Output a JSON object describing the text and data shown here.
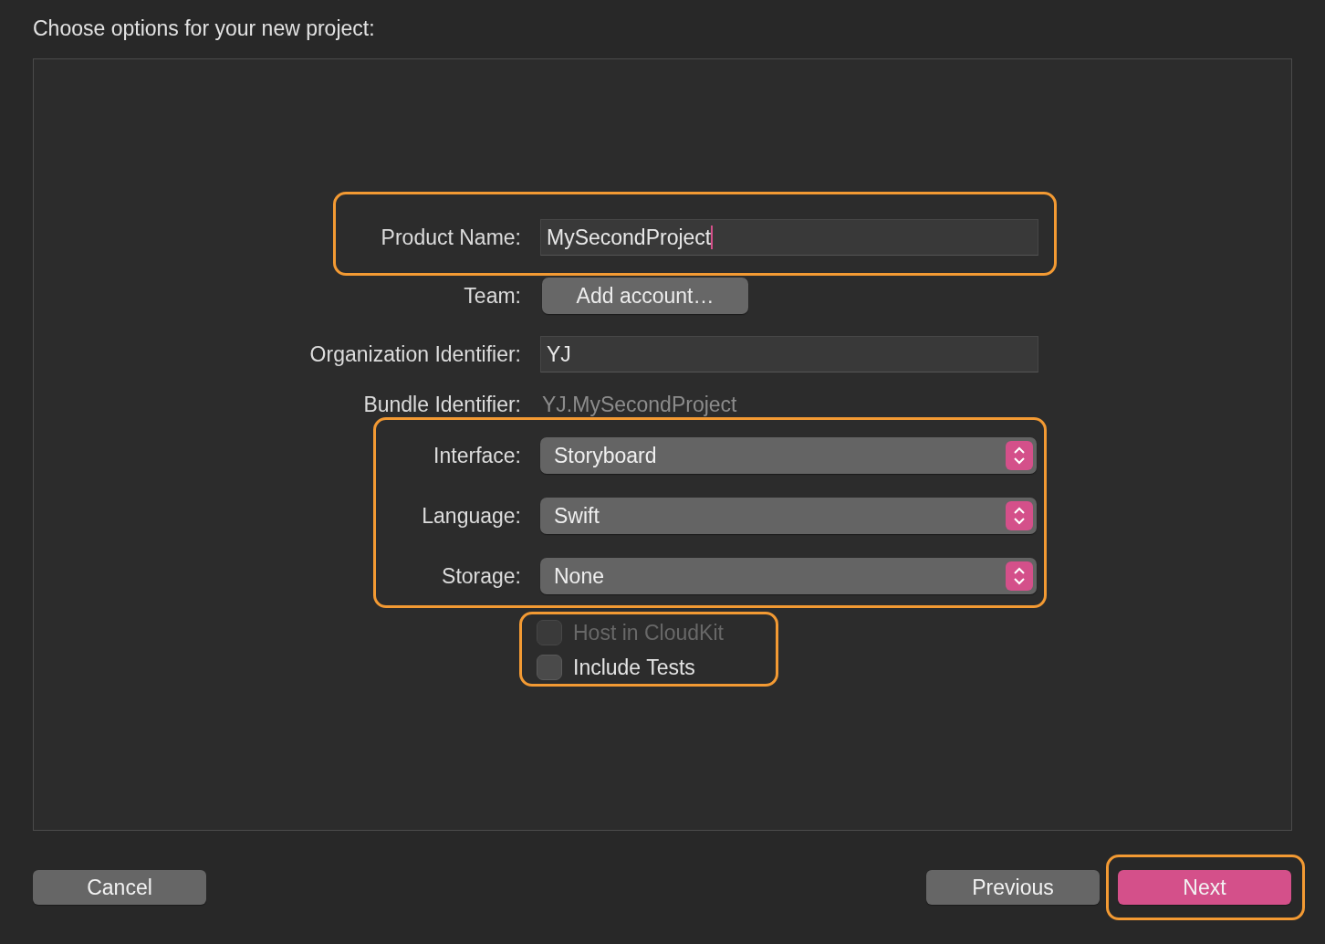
{
  "heading": "Choose options for your new project:",
  "sections": [
    {
      "highlighted": true,
      "rows": [
        {
          "kind": "text",
          "label": "Product Name:",
          "value": "MySecondProject",
          "focused": true
        }
      ]
    },
    {
      "rows": [
        {
          "kind": "button",
          "label": "Team:",
          "value": "Add account…"
        },
        {
          "kind": "text",
          "label": "Organization Identifier:",
          "value": "YJ",
          "focused": false
        },
        {
          "kind": "static",
          "label": "Bundle Identifier:",
          "value": "YJ.MySecondProject"
        }
      ]
    },
    {
      "highlighted": true,
      "rows": [
        {
          "kind": "popup",
          "label": "Interface:",
          "value": "Storyboard"
        },
        {
          "kind": "popup",
          "label": "Language:",
          "value": "Swift"
        },
        {
          "kind": "popup",
          "label": "Storage:",
          "value": "None"
        }
      ]
    }
  ],
  "options": {
    "highlighted": true,
    "items": [
      {
        "label": "Host in CloudKit",
        "checked": false,
        "disabled": true
      },
      {
        "label": "Include Tests",
        "checked": false,
        "disabled": false
      }
    ]
  },
  "buttons": [
    {
      "label": "Cancel",
      "kind": "normal"
    },
    {
      "label": "Previous",
      "kind": "normal"
    },
    {
      "label": "Next",
      "kind": "default",
      "highlighted": true
    }
  ]
}
